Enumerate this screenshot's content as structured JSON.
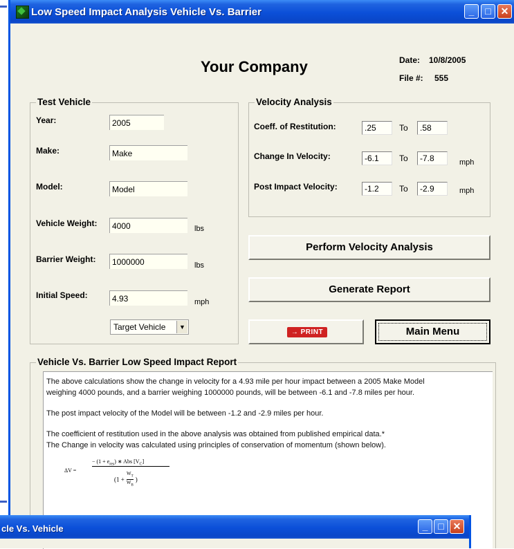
{
  "window": {
    "title": "Low Speed Impact Analysis Vehicle Vs. Barrier",
    "min_glyph": "_",
    "max_glyph": "□",
    "close_glyph": "✕"
  },
  "header": {
    "company": "Your Company",
    "date_label": "Date:",
    "date_value": "10/8/2005",
    "file_label": "File #:",
    "file_value": "555"
  },
  "test_vehicle": {
    "title": "Test Vehicle",
    "year_label": "Year:",
    "year_value": "2005",
    "make_label": "Make:",
    "make_value": "Make",
    "model_label": "Model:",
    "model_value": "Model",
    "vehicle_weight_label": "Vehicle Weight:",
    "vehicle_weight_value": "4000",
    "vehicle_weight_unit": "lbs",
    "barrier_weight_label": "Barrier Weight:",
    "barrier_weight_value": "1000000",
    "barrier_weight_unit": "lbs",
    "initial_speed_label": "Initial Speed:",
    "initial_speed_value": "4.93",
    "initial_speed_unit": "mph",
    "vehicle_type_selected": "Target Vehicle"
  },
  "velocity_analysis": {
    "title": "Velocity Analysis",
    "to_label": "To",
    "coeff_label": "Coeff. of Restitution:",
    "coeff_from": ".25",
    "coeff_to": ".58",
    "change_label": "Change In Velocity:",
    "change_from": "-6.1",
    "change_to": "-7.8",
    "change_unit": "mph",
    "post_label": "Post Impact Velocity:",
    "post_from": "-1.2",
    "post_to": "-2.9",
    "post_unit": "mph"
  },
  "buttons": {
    "perform": "Perform Velocity Analysis",
    "generate": "Generate Report",
    "print": "→ PRINT",
    "main_menu": "Main Menu"
  },
  "report": {
    "title": "Vehicle Vs. Barrier Low Speed Impact Report",
    "p1_line1": "The above calculations show the change in velocity for a 4.93 mile per hour impact between a 2005 Make Model",
    "p1_line2": "weighing 4000 pounds, and a barrier weighing 1000000 pounds, will be between -6.1 and -7.8 miles per hour.",
    "p2": "The post impact velocity of the Model will be between -1.2 and -2.9 miles per hour.",
    "p3_line1": "The coefficient of restitution used in the above analysis was obtained from published empirical data.*",
    "p3_line2": "The Change in velocity was calculated using principles of conservation of momentum (shown below).",
    "formula": {
      "lhs": "ΔV =",
      "numerator": "− (1 + e",
      "numerator_sub": "res",
      "numerator_rest": ") ∗ Abs [V",
      "numerator_sub2": "C",
      "numerator_end": "]",
      "denominator_open": "(1 +",
      "w_t": "W",
      "w_t_sub": "T",
      "w_b": "W",
      "w_b_sub": "B",
      "denominator_close": ")"
    }
  },
  "second_window": {
    "title": "cle Vs. Vehicle"
  }
}
